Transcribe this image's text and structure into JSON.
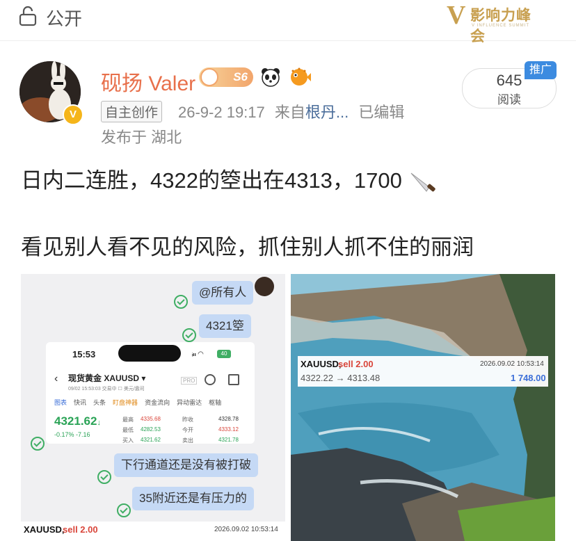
{
  "topbar": {
    "visibility_label": "公开",
    "logo": {
      "letter": "V",
      "title": "影响力峰会",
      "subtitle": "V INFLUENCE SUMMIT"
    }
  },
  "author": {
    "name": "砚扬 Valer",
    "level_badge": "S6",
    "verified_mark": "V"
  },
  "meta": {
    "source_tag": "自主创作",
    "datetime": "26-9-2 19:17",
    "from_label": "来自",
    "from_app": "根丹...",
    "edited": "已编辑",
    "location": "发布于 湖北"
  },
  "stats": {
    "read_count": "645",
    "read_label": "阅读",
    "promo_label": "推广"
  },
  "post": {
    "line1": "日内二连胜，4322的箜出在4313，1700",
    "line2": "看见别人看不见的风险，抓住别人抓不住的丽润"
  },
  "left_image": {
    "chat": {
      "mention": "@所有人",
      "msg1": "4321箜",
      "msg2": "下行通道还是没有被打破",
      "msg3": "35附近还是有压力的"
    },
    "phone": {
      "time": "15:53",
      "status": "ᵢₗₗ ◠",
      "battery": "40",
      "title": "现货黄金  XAUUSD ▾",
      "subtitle": "09/02 15:53:03   交易中   ☐ 美元/盎司",
      "pro": "PRO",
      "tabs": [
        "图表",
        "快讯",
        "头条",
        "盯盘神器",
        "资金流向",
        "异动雷达",
        "枢轴"
      ],
      "price": "4321.62",
      "change": "-0.17%   -7.16",
      "quotes": {
        "high_label": "最高",
        "high": "4335.68",
        "low_label": "最低",
        "low": "4282.53",
        "buy_label": "买入",
        "buy": "4321.62",
        "prev_label": "昨收",
        "prev": "4328.78",
        "open_label": "今开",
        "open": "4333.12",
        "sell_label": "卖出",
        "sell": "4321.78"
      }
    },
    "trade": {
      "symbol": "XAUUSD,",
      "side": "sell 2.00",
      "time": "2026.09.02 10:53:14"
    }
  },
  "right_image": {
    "trade": {
      "symbol": "XAUUSD,",
      "side": "sell 2.00",
      "time": "2026.09.02 10:53:14",
      "prices": "4322.22 → 4313.48",
      "profit": "1 748.00"
    }
  },
  "colors": {
    "name": "#e8704b",
    "link": "#4a6d9a",
    "promo": "#3c8be0",
    "profit": "#3c6fd8",
    "sell": "#d9453a"
  }
}
